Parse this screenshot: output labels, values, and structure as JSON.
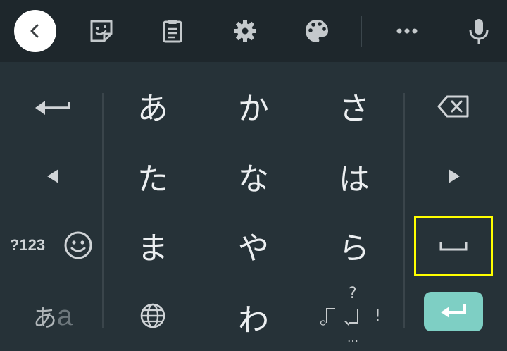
{
  "toolbar": {
    "icons": [
      "back-icon",
      "sticker-icon",
      "clipboard-icon",
      "settings-icon",
      "palette-icon",
      "more-icon",
      "mic-icon"
    ]
  },
  "keyboard": {
    "row1": [
      "あ",
      "か",
      "さ"
    ],
    "row2": [
      "た",
      "な",
      "は"
    ],
    "row3": [
      "ま",
      "や",
      "ら"
    ],
    "row4_kana": "わ",
    "symbols_label": "?123",
    "input_mode_label_1": "あ",
    "input_mode_label_2": "a",
    "punct": {
      "question": "?",
      "maru": "。",
      "ten": "、",
      "exclaim": "!",
      "ellipsis": "…"
    }
  },
  "colors": {
    "background": "#263238",
    "toolbar": "#1e272c",
    "enter": "#7ecfc4",
    "highlight": "#ffff00"
  }
}
